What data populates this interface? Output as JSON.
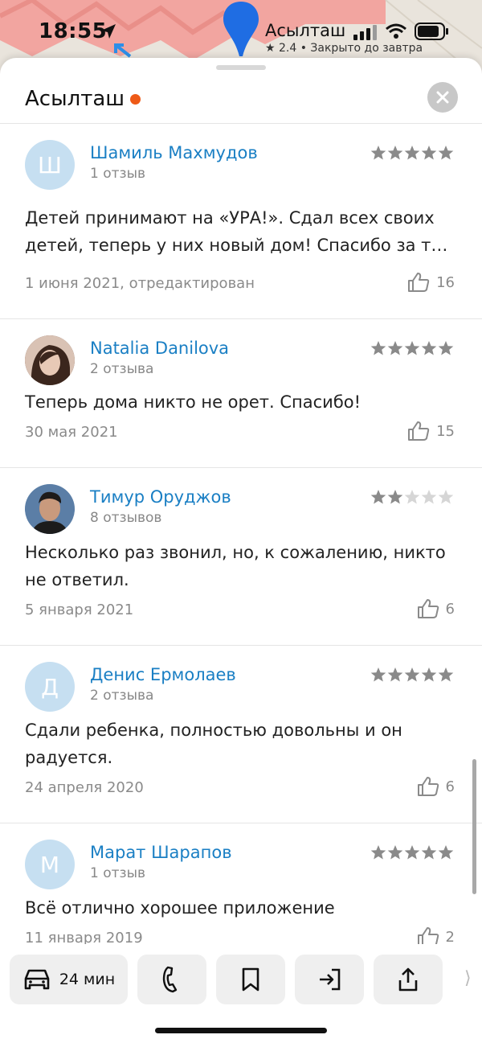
{
  "status_bar": {
    "time": "18:55"
  },
  "map_pin": {
    "name": "Асылташ",
    "subtitle": "★ 2.4 • Закрыто до завтра"
  },
  "sheet": {
    "title": "Асылташ",
    "status_dot_color": "#ee5a17"
  },
  "reviews": [
    {
      "author": "Шамиль Махмудов",
      "avatar_letter": "Ш",
      "review_count": "1 отзыв",
      "rating": 5,
      "text": "Детей принимают на «УРА!».  Сдал всех своих детей, теперь у них новый дом! Спасибо за т…",
      "date": "1 июня 2021, отредактирован",
      "likes": "16"
    },
    {
      "author": "Natalia Danilova",
      "avatar_letter": "",
      "review_count": "2 отзыва",
      "rating": 5,
      "text": "Теперь дома никто не орет. Спасибо!",
      "date": "30 мая 2021",
      "likes": "15"
    },
    {
      "author": "Тимур Оруджов",
      "avatar_letter": "",
      "review_count": "8 отзывов",
      "rating": 2,
      "text": "Несколько раз звонил, но, к сожалению, никто не ответил.",
      "date": "5 января 2021",
      "likes": "6"
    },
    {
      "author": "Денис Ермолаев",
      "avatar_letter": "Д",
      "review_count": "2 отзыва",
      "rating": 5,
      "text": "Сдали ребенка, полностью довольны и он радуется.",
      "date": "24 апреля 2020",
      "likes": "6"
    },
    {
      "author": "Марат Шарапов",
      "avatar_letter": "М",
      "review_count": "1 отзыв",
      "rating": 5,
      "text": "Всё отлично хорошее приложение",
      "date": "11 января 2019",
      "likes": "2"
    }
  ],
  "bottom_bar": {
    "route_label": "24 мин",
    "buttons": [
      "car-icon",
      "phone-icon",
      "bookmark-icon",
      "entrance-icon",
      "share-icon"
    ],
    "more_glyph": "⟩"
  },
  "colors": {
    "link": "#1a7fc4",
    "star_filled": "#8a8a8a",
    "star_empty": "#d6d6d6",
    "accent_dot": "#ee5a17"
  }
}
